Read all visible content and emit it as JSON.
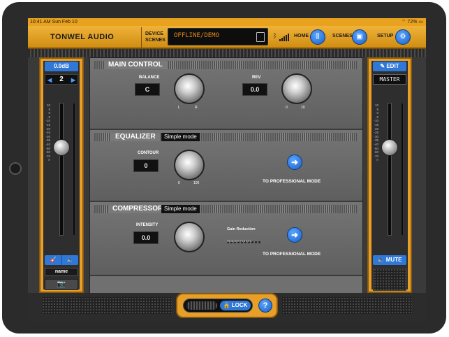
{
  "status_bar": {
    "time_date": "10:41 AM  Sun Feb 10",
    "battery": "72%"
  },
  "header": {
    "brand": "TONWEL AUDIO",
    "device_scenes_label_1": "DEVICE",
    "device_scenes_label_2": "SCENES",
    "scene_display": "OFFLINE/DEMO",
    "home_label": "HOME",
    "scenes_label": "SCENES",
    "setup_label": "SETUP"
  },
  "left_channel": {
    "gain": "0.0dB",
    "channel_number": "2",
    "fader_scale": [
      "10",
      "5",
      "0",
      "-5",
      "-10",
      "-15",
      "-20",
      "-25",
      "-30",
      "-35",
      "-40",
      "-50",
      "-60",
      "-70",
      "∞"
    ],
    "name_label": "name"
  },
  "right_channel": {
    "edit_label": "EDIT",
    "master_label": "MASTER",
    "mute_label": "MUTE",
    "fader_scale": [
      "10",
      "5",
      "0",
      "-5",
      "-10",
      "-15",
      "-20",
      "-25",
      "-30",
      "-35",
      "-40",
      "-50",
      "-60",
      "-70",
      "∞"
    ]
  },
  "main_control": {
    "title": "MAIN CONTROL",
    "balance_label": "BALANCE",
    "balance_value": "C",
    "balance_min": "L",
    "balance_max": "R",
    "rev_label": "REV",
    "rev_value": "0.0",
    "rev_min": "0",
    "rev_max": "10"
  },
  "equalizer": {
    "title": "EQUALIZER",
    "mode": "Simple mode",
    "contour_label": "CONTOUR",
    "contour_value": "0",
    "contour_min": "0",
    "contour_max": "100",
    "pro_label": "TO PROFESSIONAL MODE"
  },
  "compressor": {
    "title": "COMPRESSOR",
    "mode": "Simple mode",
    "intensity_label": "INTENSITY",
    "intensity_value": "0.0",
    "gain_reduction_label": "Gain Reduction",
    "gain_reduction_scale": "20 15 12 9 7 5 4 3 2 1",
    "pro_label": "TO PROFESSIONAL MODE"
  },
  "bottom": {
    "lock_label": "LOCK",
    "help_label": "?"
  },
  "colors": {
    "accent_orange": "#e6a02a",
    "button_blue": "#2f78d8",
    "panel_gray": "#707070"
  }
}
